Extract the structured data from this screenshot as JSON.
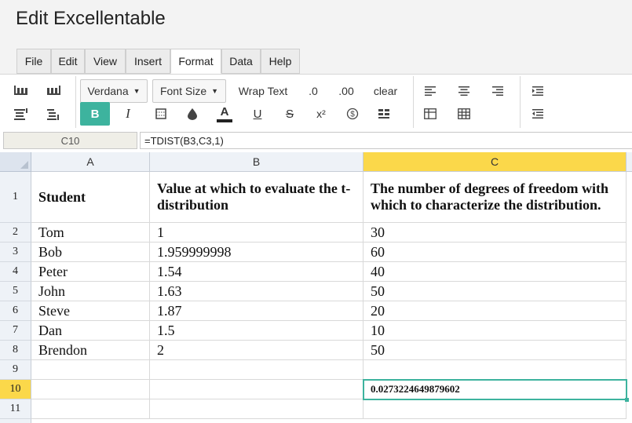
{
  "app": {
    "title": "Edit Excellentable"
  },
  "menu": [
    "File",
    "Edit",
    "View",
    "Insert",
    "Format",
    "Data",
    "Help"
  ],
  "menu_active": "Format",
  "toolbar": {
    "font_family": "Verdana",
    "font_size": "Font Size",
    "wrap_text": "Wrap Text",
    "decrease_decimals": ".0",
    "increase_decimals": ".00",
    "clear": "clear",
    "bold": "B",
    "italic": "I",
    "text_color": "A",
    "underline": "U",
    "strikethrough": "S",
    "superscript": "x²",
    "accent_color": "#3db39e"
  },
  "formula_bar": {
    "cell_ref": "C10",
    "formula": "=TDIST(B3,C3,1)"
  },
  "grid": {
    "columns": [
      "A",
      "B",
      "C"
    ],
    "selected_column": "C",
    "selected_row": "10",
    "rows": [
      {
        "n": "1",
        "cells": [
          "Student",
          "Value at which to evaluate the t-distribution",
          "The number of degrees of freedom with which to characterize the distribution."
        ]
      },
      {
        "n": "2",
        "cells": [
          "Tom",
          "1",
          "30"
        ]
      },
      {
        "n": "3",
        "cells": [
          "Bob",
          "1.959999998",
          "60"
        ]
      },
      {
        "n": "4",
        "cells": [
          "Peter",
          "1.54",
          "40"
        ]
      },
      {
        "n": "5",
        "cells": [
          "John",
          "1.63",
          "50"
        ]
      },
      {
        "n": "6",
        "cells": [
          "Steve",
          "1.87",
          "20"
        ]
      },
      {
        "n": "7",
        "cells": [
          "Dan",
          "1.5",
          "10"
        ]
      },
      {
        "n": "8",
        "cells": [
          "Brendon",
          "2",
          "50"
        ]
      },
      {
        "n": "9",
        "cells": [
          "",
          "",
          ""
        ]
      },
      {
        "n": "10",
        "cells": [
          "",
          "",
          "0.0273224649879602"
        ]
      },
      {
        "n": "11",
        "cells": [
          "",
          "",
          ""
        ]
      }
    ]
  }
}
